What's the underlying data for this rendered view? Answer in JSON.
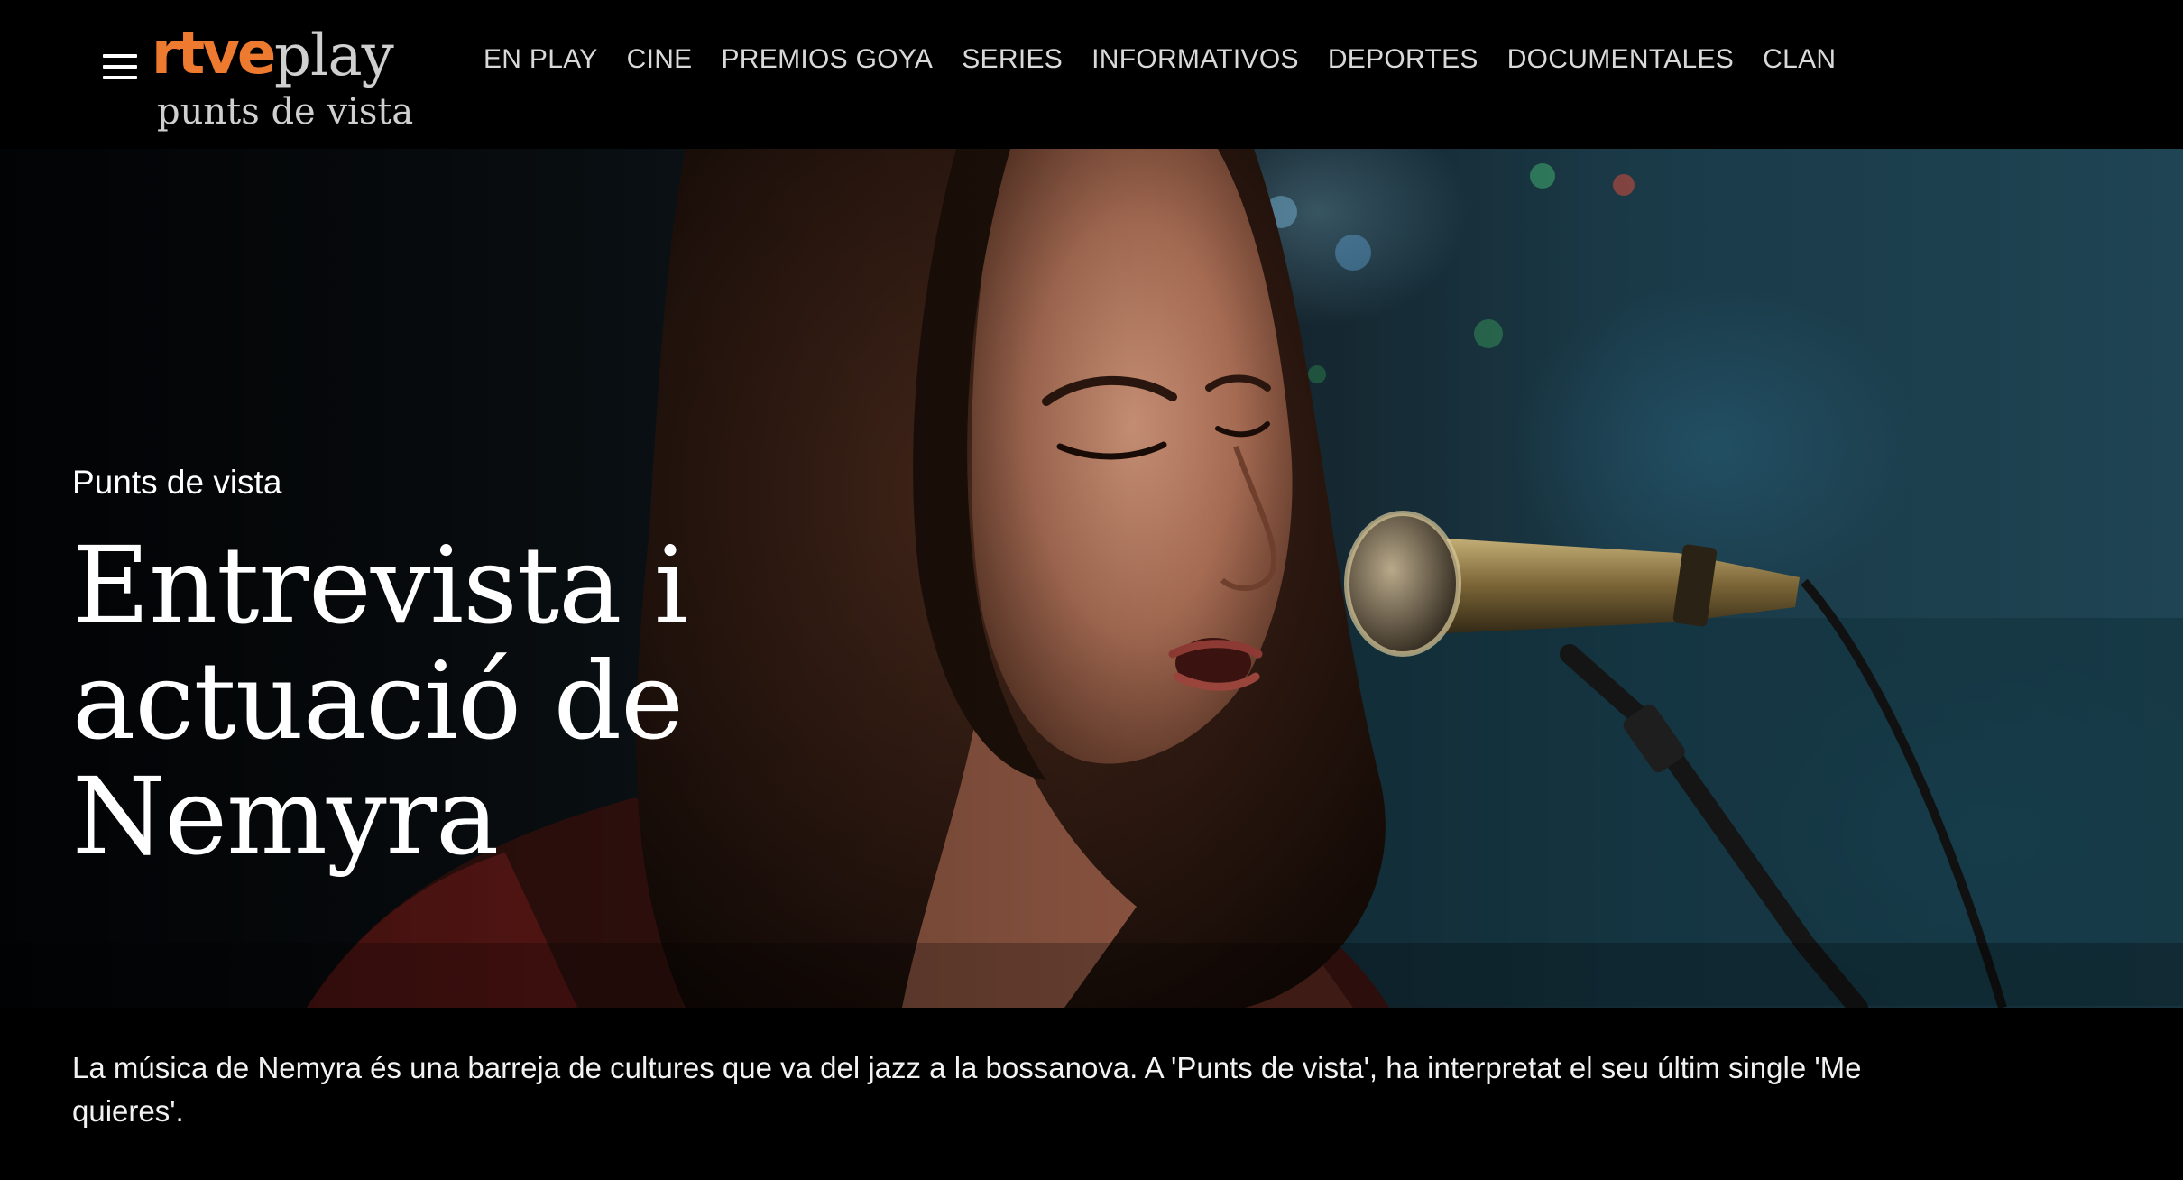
{
  "header": {
    "menu_icon": "hamburger-menu-icon",
    "logo": {
      "brand": "rtve",
      "product": "play",
      "program": "punts de vista"
    },
    "nav": [
      {
        "label": "EN PLAY"
      },
      {
        "label": "CINE"
      },
      {
        "label": "PREMIOS GOYA"
      },
      {
        "label": "SERIES"
      },
      {
        "label": "INFORMATIVOS"
      },
      {
        "label": "DEPORTES"
      },
      {
        "label": "DOCUMENTALES"
      },
      {
        "label": "CLAN"
      }
    ]
  },
  "hero": {
    "kicker": "Punts de vista",
    "title": "Entrevista i actuació de Nemyra",
    "image": "singer-with-microphone-photo"
  },
  "description": "La música de Nemyra és una barreja de cultures que va del jazz a la bossanova. A 'Punts de vista', ha interpretat el seu últim single 'Me quieres'.",
  "colors": {
    "brand_orange": "#ee7a2f",
    "background": "#000000",
    "text": "#ffffff",
    "nav_text": "#d9d9d9"
  }
}
